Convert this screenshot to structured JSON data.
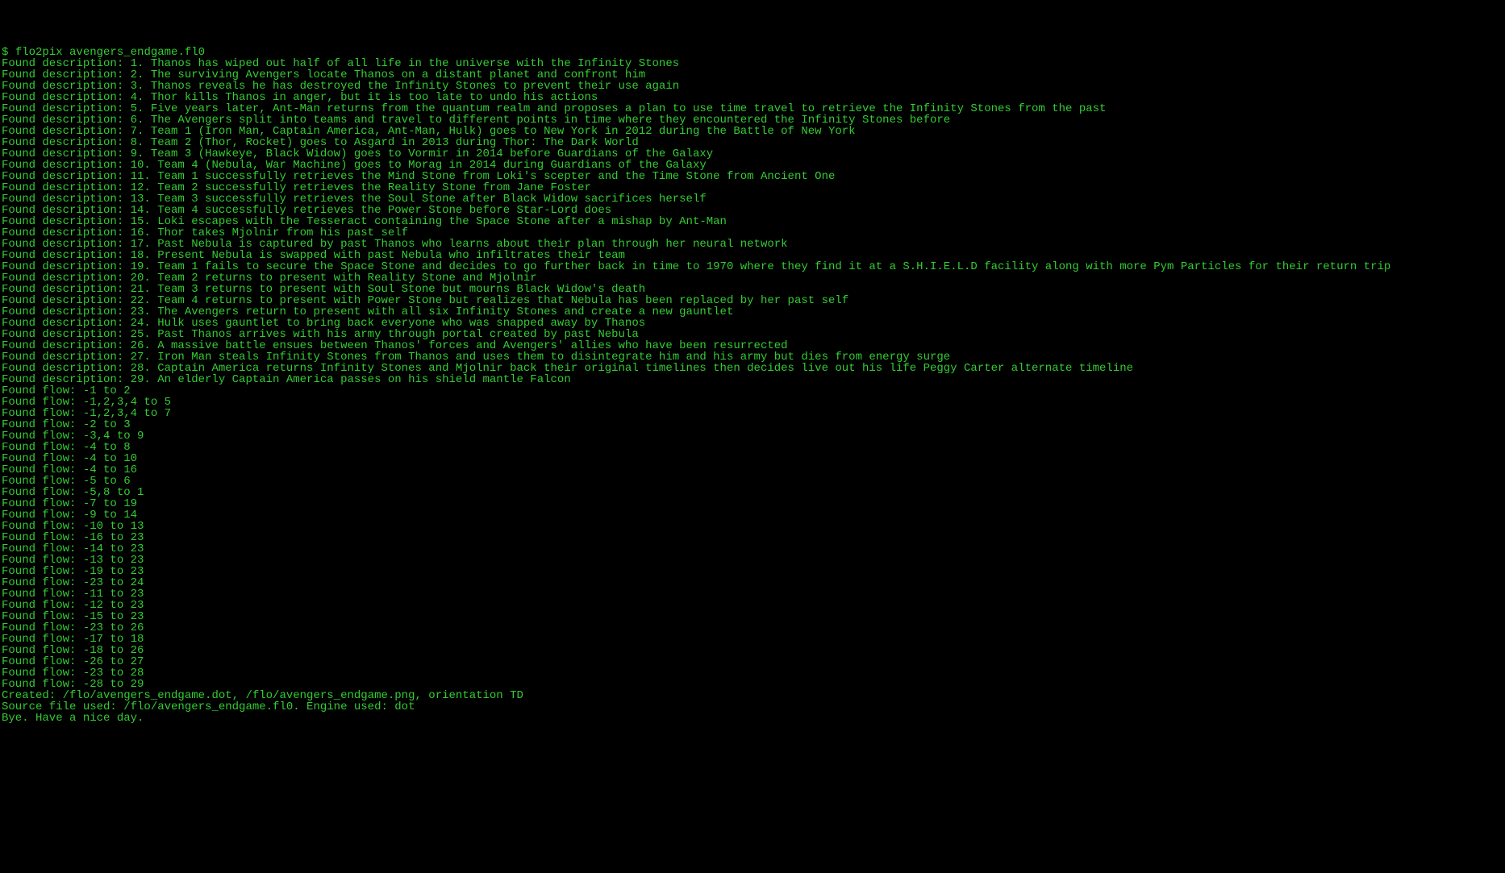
{
  "terminal": {
    "prompt": "$ ",
    "command": "flo2pix avengers_endgame.fl0",
    "descriptions": [
      "Found description: 1. Thanos has wiped out half of all life in the universe with the Infinity Stones",
      "Found description: 2. The surviving Avengers locate Thanos on a distant planet and confront him",
      "Found description: 3. Thanos reveals he has destroyed the Infinity Stones to prevent their use again",
      "Found description: 4. Thor kills Thanos in anger, but it is too late to undo his actions",
      "Found description: 5. Five years later, Ant-Man returns from the quantum realm and proposes a plan to use time travel to retrieve the Infinity Stones from the past",
      "Found description: 6. The Avengers split into teams and travel to different points in time where they encountered the Infinity Stones before",
      "Found description: 7. Team 1 (Iron Man, Captain America, Ant-Man, Hulk) goes to New York in 2012 during the Battle of New York",
      "Found description: 8. Team 2 (Thor, Rocket) goes to Asgard in 2013 during Thor: The Dark World",
      "Found description: 9. Team 3 (Hawkeye, Black Widow) goes to Vormir in 2014 before Guardians of the Galaxy",
      "Found description: 10. Team 4 (Nebula, War Machine) goes to Morag in 2014 during Guardians of the Galaxy",
      "Found description: 11. Team 1 successfully retrieves the Mind Stone from Loki's scepter and the Time Stone from Ancient One",
      "Found description: 12. Team 2 successfully retrieves the Reality Stone from Jane Foster",
      "Found description: 13. Team 3 successfully retrieves the Soul Stone after Black Widow sacrifices herself",
      "Found description: 14. Team 4 successfully retrieves the Power Stone before Star-Lord does",
      "Found description: 15. Loki escapes with the Tesseract containing the Space Stone after a mishap by Ant-Man",
      "Found description: 16. Thor takes Mjolnir from his past self",
      "Found description: 17. Past Nebula is captured by past Thanos who learns about their plan through her neural network",
      "Found description: 18. Present Nebula is swapped with past Nebula who infiltrates their team",
      "Found description: 19. Team 1 fails to secure the Space Stone and decides to go further back in time to 1970 where they find it at a S.H.I.E.L.D facility along with more Pym Particles for their return trip",
      "Found description: 20. Team 2 returns to present with Reality Stone and Mjolnir",
      "Found description: 21. Team 3 returns to present with Soul Stone but mourns Black Widow's death",
      "Found description: 22. Team 4 returns to present with Power Stone but realizes that Nebula has been replaced by her past self",
      "Found description: 23. The Avengers return to present with all six Infinity Stones and create a new gauntlet",
      "Found description: 24. Hulk uses gauntlet to bring back everyone who was snapped away by Thanos",
      "Found description: 25. Past Thanos arrives with his army through portal created by past Nebula",
      "Found description: 26. A massive battle ensues between Thanos' forces and Avengers' allies who have been resurrected",
      "Found description: 27. Iron Man steals Infinity Stones from Thanos and uses them to disintegrate him and his army but dies from energy surge",
      "Found description: 28. Captain America returns Infinity Stones and Mjolnir back their original timelines then decides live out his life Peggy Carter alternate timeline",
      "Found description: 29. An elderly Captain America passes on his shield mantle Falcon"
    ],
    "flows": [
      "Found flow: -1 to 2",
      "Found flow: -1,2,3,4 to 5",
      "Found flow: -1,2,3,4 to 7",
      "Found flow: -2 to 3",
      "Found flow: -3,4 to 9",
      "Found flow: -4 to 8",
      "Found flow: -4 to 10",
      "Found flow: -4 to 16",
      "Found flow: -5 to 6",
      "Found flow: -5,8 to 1",
      "Found flow: -7 to 19",
      "Found flow: -9 to 14",
      "Found flow: -10 to 13",
      "Found flow: -16 to 23",
      "Found flow: -14 to 23",
      "Found flow: -13 to 23",
      "Found flow: -19 to 23",
      "Found flow: -23 to 24",
      "Found flow: -11 to 23",
      "Found flow: -12 to 23",
      "Found flow: -15 to 23",
      "Found flow: -23 to 26",
      "Found flow: -17 to 18",
      "Found flow: -18 to 26",
      "Found flow: -26 to 27",
      "Found flow: -23 to 28",
      "Found flow: -28 to 29"
    ],
    "footer": [
      "Created: /flo/avengers_endgame.dot, /flo/avengers_endgame.png, orientation TD",
      "Source file used: /flo/avengers_endgame.fl0. Engine used: dot",
      "Bye. Have a nice day."
    ]
  }
}
